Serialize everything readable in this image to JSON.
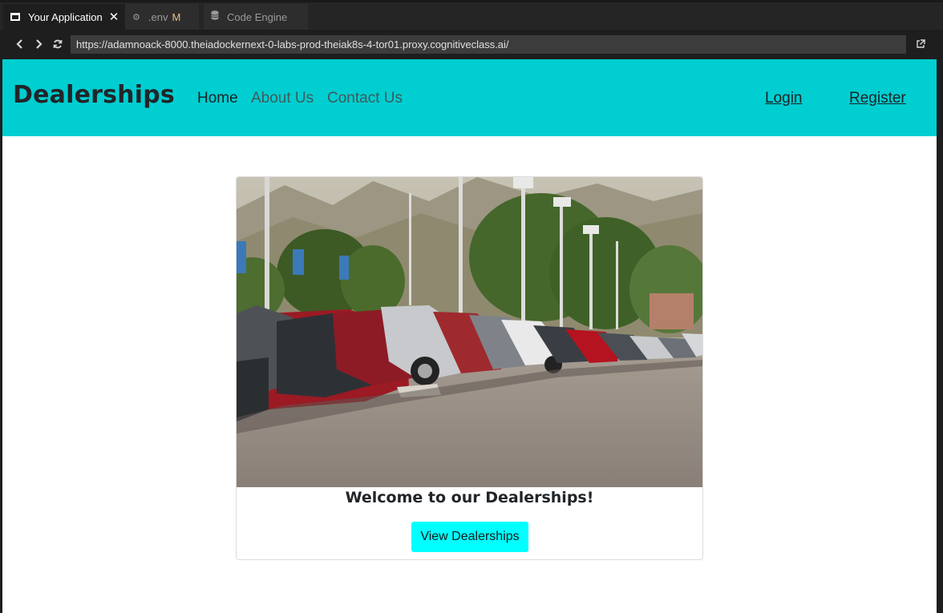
{
  "browser": {
    "tabs": [
      {
        "label": "Your Application",
        "icon": "window-icon",
        "active": true
      },
      {
        "label": ".env",
        "icon": "gear-icon",
        "modified": "M"
      },
      {
        "label": "Code Engine",
        "icon": "database-icon"
      }
    ],
    "url": "https://adamnoack-8000.theiadockernext-0-labs-prod-theiak8s-4-tor01.proxy.cognitiveclass.ai/"
  },
  "site": {
    "brand": "Dealerships",
    "nav": [
      {
        "label": "Home",
        "active": true
      },
      {
        "label": "About Us"
      },
      {
        "label": "Contact Us"
      }
    ],
    "auth": {
      "login": "Login",
      "register": "Register"
    },
    "colors": {
      "navbar": "#00ced1",
      "button": "#00ffff"
    }
  },
  "card": {
    "image_alt": "car-lot-photo",
    "title": "Welcome to our Dealerships!",
    "button": "View Dealerships"
  }
}
